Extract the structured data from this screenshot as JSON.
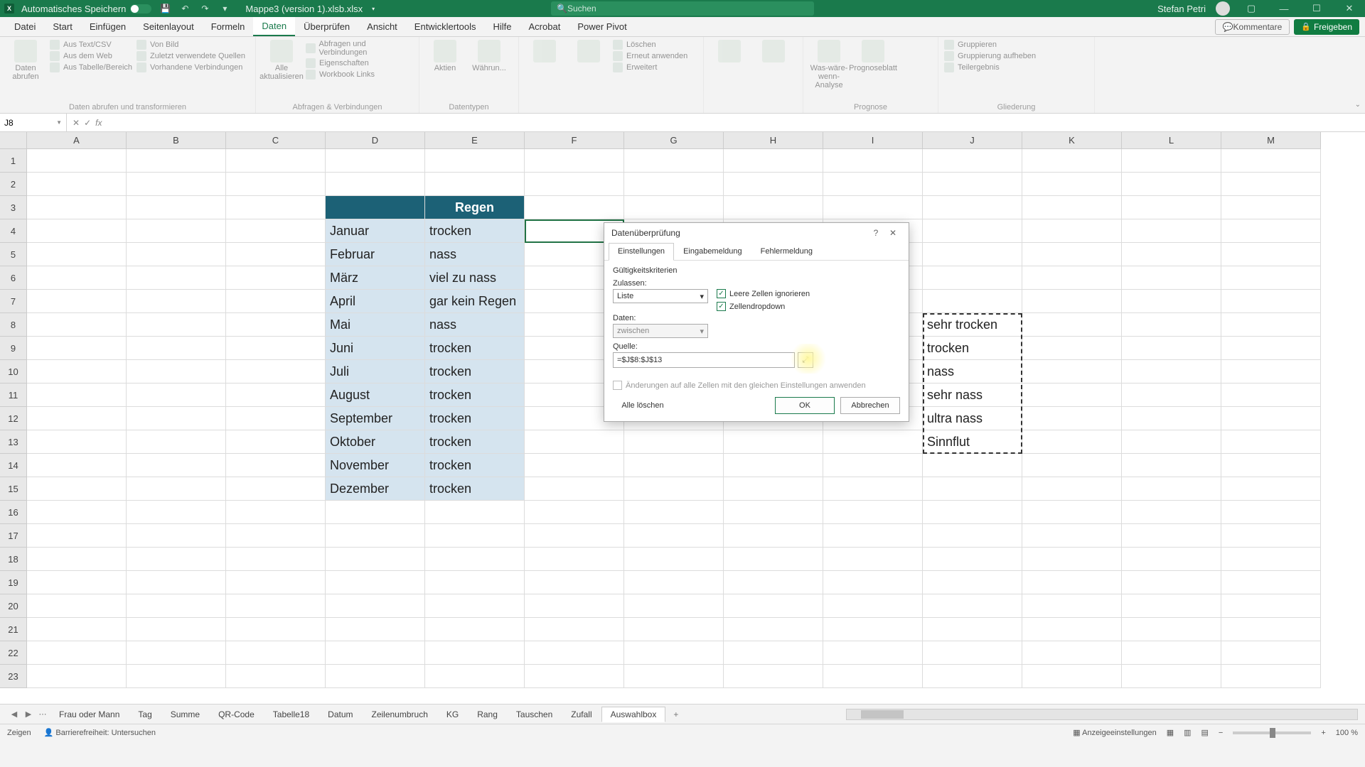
{
  "titlebar": {
    "autosave_label": "Automatisches Speichern",
    "filename": "Mappe3 (version 1).xlsb.xlsx",
    "search_placeholder": "Suchen",
    "username": "Stefan Petri"
  },
  "tabs": {
    "items": [
      "Datei",
      "Start",
      "Einfügen",
      "Seitenlayout",
      "Formeln",
      "Daten",
      "Überprüfen",
      "Ansicht",
      "Entwicklertools",
      "Hilfe",
      "Acrobat",
      "Power Pivot"
    ],
    "active": "Daten",
    "comments": "Kommentare",
    "share": "Freigeben"
  },
  "ribbon": {
    "g1": {
      "label": "Daten abrufen und transformieren",
      "big": "Daten\nabrufen",
      "items": [
        "Aus Text/CSV",
        "Aus dem Web",
        "Aus Tabelle/Bereich",
        "Von Bild",
        "Zuletzt verwendete Quellen",
        "Vorhandene Verbindungen"
      ]
    },
    "g2": {
      "label": "Abfragen & Verbindungen",
      "big": "Alle\naktualisieren",
      "items": [
        "Abfragen und Verbindungen",
        "Eigenschaften",
        "Workbook Links"
      ]
    },
    "g3": {
      "label": "Datentypen",
      "big1": "Aktien",
      "big2": "Währun..."
    },
    "g4": {
      "label": "",
      "items": [
        "Löschen",
        "Erneut anwenden",
        "Erweitert"
      ]
    },
    "g5": {
      "label": "Prognose",
      "big1": "Was-wäre-wenn-\nAnalyse",
      "big2": "Prognoseblatt"
    },
    "g6": {
      "label": "Gliederung",
      "items": [
        "Gruppieren",
        "Gruppierung aufheben",
        "Teilergebnis"
      ]
    }
  },
  "namebox": "J8",
  "columns": [
    "A",
    "B",
    "C",
    "D",
    "E",
    "F",
    "G",
    "H",
    "I",
    "J",
    "K",
    "L",
    "M"
  ],
  "rows_count": 23,
  "table": {
    "header": {
      "d": "",
      "e": "Regen"
    },
    "rows": [
      {
        "d": "Januar",
        "e": "trocken"
      },
      {
        "d": "Februar",
        "e": "nass"
      },
      {
        "d": "März",
        "e": "viel zu nass"
      },
      {
        "d": "April",
        "e": "gar kein Regen"
      },
      {
        "d": "Mai",
        "e": "nass"
      },
      {
        "d": "Juni",
        "e": "trocken"
      },
      {
        "d": "Juli",
        "e": "trocken"
      },
      {
        "d": "August",
        "e": "trocken"
      },
      {
        "d": "September",
        "e": "trocken"
      },
      {
        "d": "Oktober",
        "e": "trocken"
      },
      {
        "d": "November",
        "e": "trocken"
      },
      {
        "d": "Dezember",
        "e": "trocken"
      }
    ]
  },
  "sourcelist": [
    "sehr trocken",
    "trocken",
    "nass",
    "sehr nass",
    "ultra nass",
    "Sinnflut"
  ],
  "dialog": {
    "title": "Datenüberprüfung",
    "tabs": [
      "Einstellungen",
      "Eingabemeldung",
      "Fehlermeldung"
    ],
    "section": "Gültigkeitskriterien",
    "allow_label": "Zulassen:",
    "allow_value": "Liste",
    "data_label": "Daten:",
    "data_value": "zwischen",
    "source_label": "Quelle:",
    "source_value": "=$J$8:$J$13",
    "ignore_blank": "Leere Zellen ignorieren",
    "cell_dropdown": "Zellendropdown",
    "apply_all": "Änderungen auf alle Zellen mit den gleichen Einstellungen anwenden",
    "clear": "Alle löschen",
    "ok": "OK",
    "cancel": "Abbrechen"
  },
  "sheets": {
    "items": [
      "Frau oder Mann",
      "Tag",
      "Summe",
      "QR-Code",
      "Tabelle18",
      "Datum",
      "Zeilenumbruch",
      "KG",
      "Rang",
      "Tauschen",
      "Zufall",
      "Auswahlbox"
    ],
    "active": "Auswahlbox"
  },
  "status": {
    "mode": "Zeigen",
    "accessibility": "Barrierefreiheit: Untersuchen",
    "display": "Anzeigeeinstellungen",
    "zoom": "100 %"
  }
}
